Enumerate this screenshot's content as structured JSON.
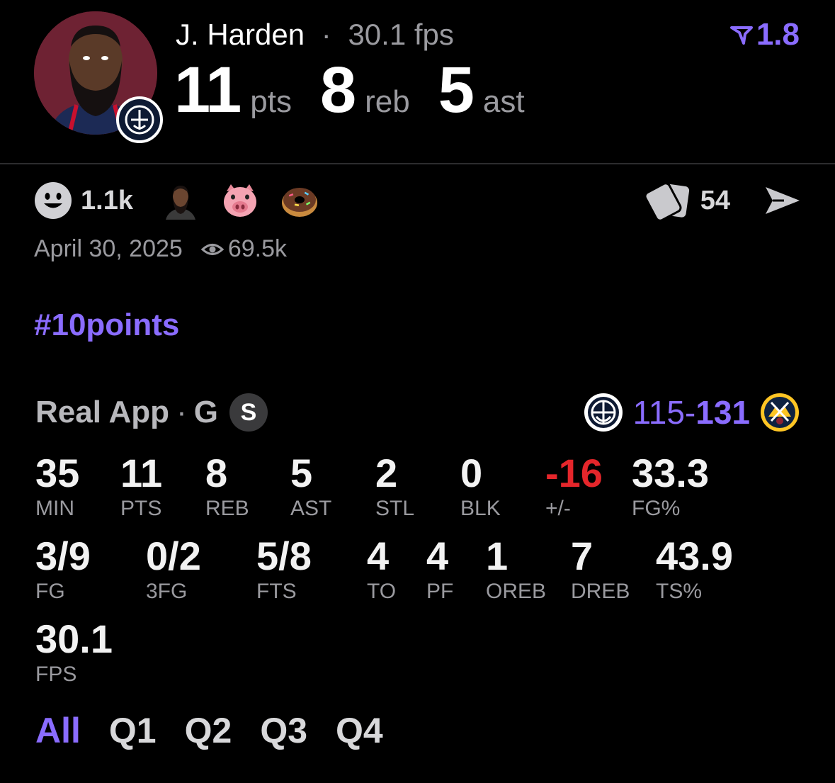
{
  "header": {
    "player_name": "J. Harden",
    "separator": "·",
    "fps_text": "30.1 fps",
    "multiplier": "1.8",
    "stats": [
      {
        "value": "11",
        "unit": "pts"
      },
      {
        "value": "8",
        "unit": "reb"
      },
      {
        "value": "5",
        "unit": "ast"
      }
    ]
  },
  "reactions": {
    "count": "1.1k",
    "emojis": [
      "player-face",
      "pig-face",
      "donut"
    ],
    "cards_count": "54"
  },
  "meta": {
    "date": "April 30, 2025",
    "views": "69.5k"
  },
  "hashtag": "#10points",
  "game": {
    "app": "Real App",
    "separator": "·",
    "position": "G",
    "badge": "S",
    "score_away": "115",
    "score_dash": "-",
    "score_home": "131"
  },
  "box_score": {
    "row1": [
      {
        "value": "35",
        "label": "MIN"
      },
      {
        "value": "11",
        "label": "PTS"
      },
      {
        "value": "8",
        "label": "REB"
      },
      {
        "value": "5",
        "label": "AST"
      },
      {
        "value": "2",
        "label": "STL"
      },
      {
        "value": "0",
        "label": "BLK"
      },
      {
        "value": "-16",
        "label": "+/-"
      },
      {
        "value": "33.3",
        "label": "FG%"
      }
    ],
    "row2": [
      {
        "value": "3/9",
        "label": "FG"
      },
      {
        "value": "0/2",
        "label": "3FG"
      },
      {
        "value": "5/8",
        "label": "FTS"
      },
      {
        "value": "4",
        "label": "TO"
      },
      {
        "value": "4",
        "label": "PF"
      },
      {
        "value": "1",
        "label": "OREB"
      },
      {
        "value": "7",
        "label": "DREB"
      },
      {
        "value": "43.9",
        "label": "TS%"
      }
    ],
    "row3": [
      {
        "value": "30.1",
        "label": "FPS"
      }
    ]
  },
  "tabs": [
    "All",
    "Q1",
    "Q2",
    "Q3",
    "Q4"
  ],
  "colors": {
    "accent": "#8a6cff",
    "negative": "#e5262b",
    "muted": "#9a9a9f"
  }
}
